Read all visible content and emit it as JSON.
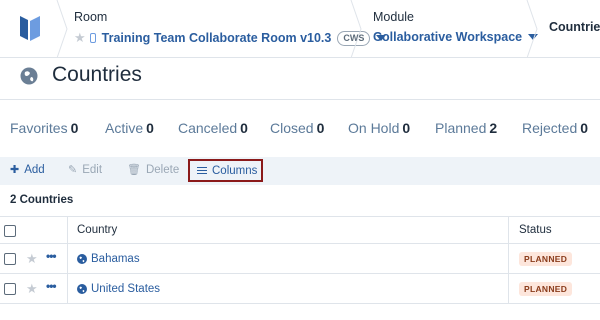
{
  "breadcrumb": {
    "room_label": "Room",
    "room_value": "Training Team Collaborate Room v10.3",
    "room_badge": "CWS",
    "module_label": "Module",
    "module_value": "Collaborative Workspace",
    "current": "Countries"
  },
  "page": {
    "title": "Countries",
    "icon": "globe-icon"
  },
  "status_tabs": [
    {
      "label": "Favorites",
      "count": "0"
    },
    {
      "label": "Active",
      "count": "0"
    },
    {
      "label": "Canceled",
      "count": "0"
    },
    {
      "label": "Closed",
      "count": "0"
    },
    {
      "label": "On Hold",
      "count": "0"
    },
    {
      "label": "Planned",
      "count": "2"
    },
    {
      "label": "Rejected",
      "count": "0"
    }
  ],
  "toolbar": {
    "add": "Add",
    "edit": "Edit",
    "delete": "Delete",
    "columns": "Columns"
  },
  "count_label": "2 Countries",
  "table": {
    "headers": {
      "country": "Country",
      "status": "Status"
    },
    "rows": [
      {
        "country": "Bahamas",
        "status": "PLANNED"
      },
      {
        "country": "United States",
        "status": "PLANNED"
      }
    ]
  },
  "colors": {
    "accent": "#2a5d9f",
    "highlight_border": "#8b1a1a",
    "pill_bg": "#fde6dc",
    "toolbar_bg": "#eef3f8"
  }
}
